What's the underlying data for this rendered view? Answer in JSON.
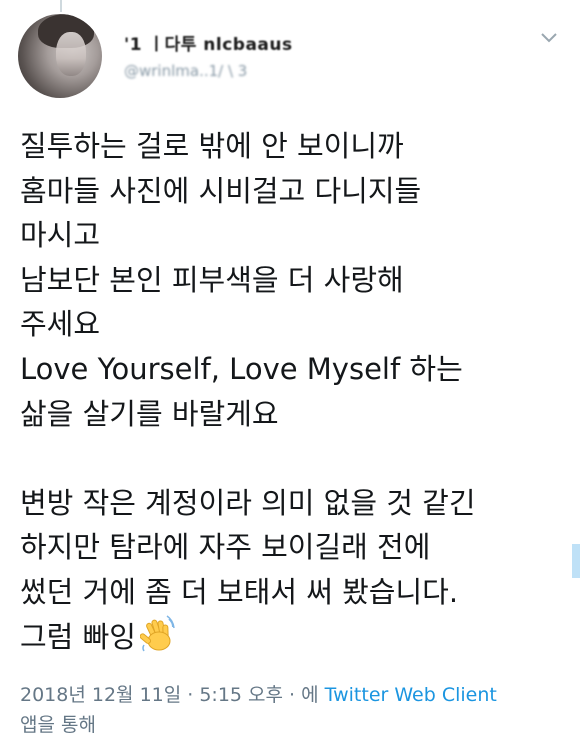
{
  "tweet": {
    "display_name": "'1 ㅣ다투 nlcbaaus",
    "handle": "@wrinlma..1/ \\ 3",
    "text_part1": "질투하는 걸로 밖에 안 보이니까\n홈마들 사진에 시비걸고 다니지들\n마시고\n남보단 본인 피부색을 더 사랑해\n주세요\nLove Yourself, Love Myself 하는\n삶을 살기를 바랄게요\n\n변방 작은 계정이라 의미 없을 것 같긴\n하지만 탐라에 자주 보이길래 전에\n썼던 거에 좀 더 보태서 써 봤습니다.\n그럼 빠잉",
    "emoji": "waving-hand-emoji",
    "timestamp_prefix": "2018년 12월 11일 · 5:15 오후 · 에 ",
    "source_link": "Twitter Web Client",
    "timestamp_suffix": "앱을 통해"
  },
  "icons": {
    "menu": "chevron-down-icon",
    "avatar": "profile-photo"
  },
  "colors": {
    "text": "#14171a",
    "secondary": "#657786",
    "link": "#1b95e0"
  }
}
